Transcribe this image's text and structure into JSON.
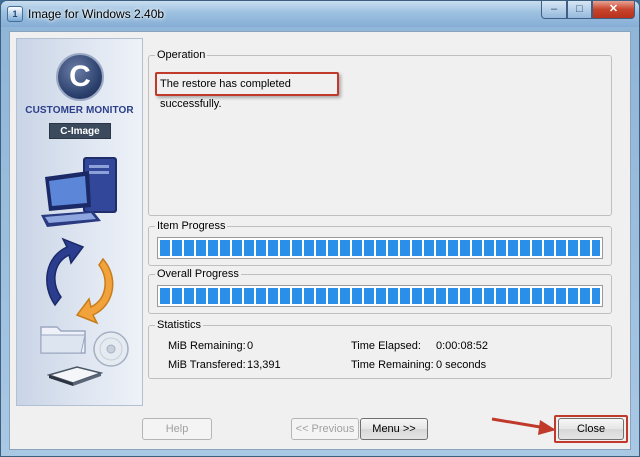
{
  "window": {
    "title": "Image for Windows 2.40b",
    "controls": {
      "minimize": "–",
      "maximize": "□",
      "close": "✕"
    }
  },
  "brand": {
    "logo_letter": "C",
    "name": "CUSTOMER MONITOR",
    "product": "C-Image",
    "icons": [
      "computer-icon",
      "refresh-arrows-icon",
      "folder-icon",
      "disc-icon",
      "drive-icon"
    ]
  },
  "operation": {
    "legend": "Operation",
    "message": "The restore has completed successfully."
  },
  "item_progress": {
    "legend": "Item Progress",
    "fraction": 1.0
  },
  "overall_progress": {
    "legend": "Overall Progress",
    "fraction": 1.0
  },
  "statistics": {
    "legend": "Statistics",
    "mib_remaining_label": "MiB Remaining:",
    "mib_remaining_value": "0",
    "mib_transfered_label": "MiB Transfered:",
    "mib_transfered_value": "13,391",
    "time_elapsed_label": "Time Elapsed:",
    "time_elapsed_value": "0:00:08:52",
    "time_remaining_label": "Time Remaining:",
    "time_remaining_value": "0 seconds"
  },
  "buttons": {
    "help": "Help",
    "previous": "<< Previous",
    "menu": "Menu >>",
    "close": "Close"
  },
  "colors": {
    "accent_red": "#c0392b",
    "progress_blue": "#2a8fe8",
    "brand_blue": "#2b3f8a"
  }
}
